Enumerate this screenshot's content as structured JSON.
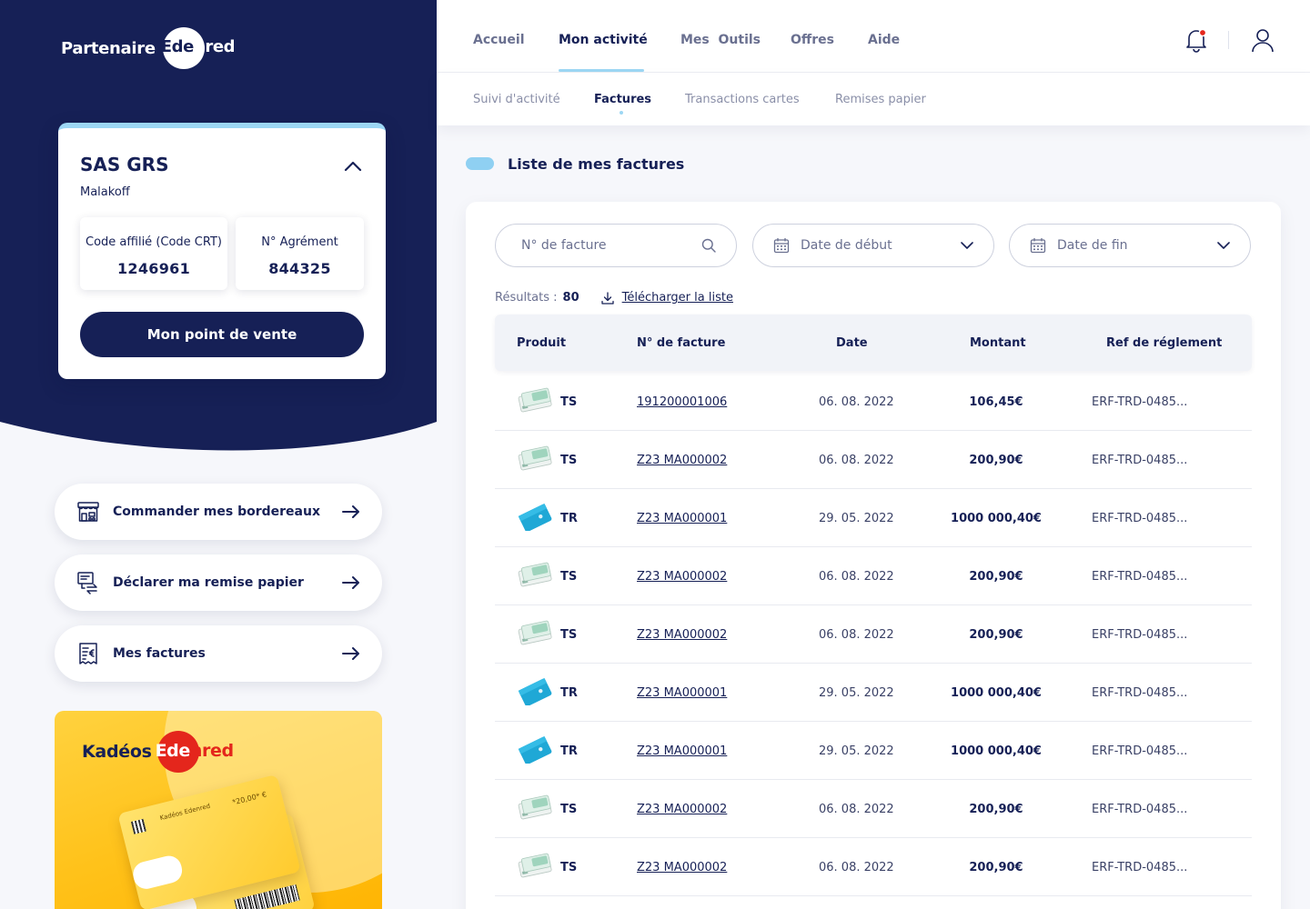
{
  "brand": {
    "prefix": "Partenaire",
    "word_left": "Ede",
    "word_right": "nred"
  },
  "account": {
    "name": "SAS GRS",
    "city": "Malakoff",
    "code_label": "Code affilié (Code CRT)",
    "code_value": "1246961",
    "agrement_label": "N° Agrément",
    "agrement_value": "844325",
    "button_label": "Mon point de vente"
  },
  "actions": [
    {
      "label": "Commander mes bordereaux",
      "icon": "shop-icon"
    },
    {
      "label": "Déclarer ma remise papier",
      "icon": "paper-transfer-icon"
    },
    {
      "label": "Mes factures",
      "icon": "invoice-icon"
    }
  ],
  "promo": {
    "brand": "Kadéos",
    "word_left": "Ede",
    "word_right": "nred",
    "card_amount": "*20,00* €",
    "card_text": "Kadéos Edenred"
  },
  "nav": {
    "items": [
      "Accueil",
      "Mon activité",
      "Mes  Outils",
      "Offres",
      "Aide"
    ],
    "active_index": 1
  },
  "subnav": {
    "items": [
      "Suivi d'activité",
      "Factures",
      "Transactions cartes",
      "Remises papier"
    ],
    "active_index": 1
  },
  "section_title": "Liste de mes factures",
  "filters": {
    "invoice_placeholder": "N° de facture",
    "start_date": "Date de début",
    "end_date": "Date de fin"
  },
  "results": {
    "label": "Résultats :",
    "count": "80",
    "download_label": "Télécharger la liste"
  },
  "table": {
    "columns": [
      "Produit",
      "N° de facture",
      "Date",
      "Montant",
      "Ref de réglement"
    ],
    "rows": [
      {
        "product": "TS",
        "number": "191200001006",
        "date": "06. 08. 2022",
        "amount": "106,45€",
        "ref": "ERF-TRD-0485..."
      },
      {
        "product": "TS",
        "number": "Z23 MA000002",
        "date": "06. 08. 2022",
        "amount": "200,90€",
        "ref": "ERF-TRD-0485..."
      },
      {
        "product": "TR",
        "number": "Z23 MA000001",
        "date": "29. 05. 2022",
        "amount": "1000 000,40€",
        "ref": "ERF-TRD-0485..."
      },
      {
        "product": "TS",
        "number": "Z23 MA000002",
        "date": "06. 08. 2022",
        "amount": "200,90€",
        "ref": "ERF-TRD-0485..."
      },
      {
        "product": "TS",
        "number": "Z23 MA000002",
        "date": "06. 08. 2022",
        "amount": "200,90€",
        "ref": "ERF-TRD-0485..."
      },
      {
        "product": "TR",
        "number": "Z23 MA000001",
        "date": "29. 05. 2022",
        "amount": "1000 000,40€",
        "ref": "ERF-TRD-0485..."
      },
      {
        "product": "TR",
        "number": "Z23 MA000001",
        "date": "29. 05. 2022",
        "amount": "1000 000,40€",
        "ref": "ERF-TRD-0485..."
      },
      {
        "product": "TS",
        "number": "Z23 MA000002",
        "date": "06. 08. 2022",
        "amount": "200,90€",
        "ref": "ERF-TRD-0485..."
      },
      {
        "product": "TS",
        "number": "Z23 MA000002",
        "date": "06. 08. 2022",
        "amount": "200,90€",
        "ref": "ERF-TRD-0485..."
      }
    ]
  },
  "colors": {
    "navy": "#162056",
    "accent": "#9dd7f4",
    "notification": "#e4261c",
    "ts_card": "#cfe9de",
    "tr_card": "#1fa8d6",
    "promo_yellow": "#ffc21a"
  }
}
